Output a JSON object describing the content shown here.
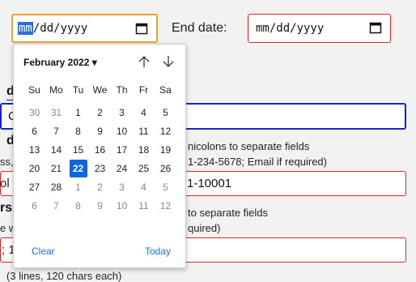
{
  "start_date": {
    "seg_month": "mm",
    "rest": "/dd/yyyy"
  },
  "end_date": {
    "label": "End date:",
    "value": "mm/dd/yyyy"
  },
  "background": {
    "label_d1": "d",
    "field1_char": "C",
    "label_d2": "d",
    "help1": "nicolons to separate fields",
    "help2_left": "ss,",
    "help2_right": "1-234-5678; Email if required)",
    "label_ol": "ol",
    "field2_value": "1-10001",
    "label_rs": "rs",
    "help3": "to separate fields",
    "help4_left": "e w",
    "help4_right": "quired)",
    "field3_left": "; 1",
    "footer": "(3 lines, 120 chars each)"
  },
  "calendar": {
    "month_label": "February 2022 ▾",
    "weekdays": [
      "Su",
      "Mo",
      "Tu",
      "We",
      "Th",
      "Fr",
      "Sa"
    ],
    "weeks": [
      [
        "30",
        "31",
        "1",
        "2",
        "3",
        "4",
        "5"
      ],
      [
        "6",
        "7",
        "8",
        "9",
        "10",
        "11",
        "12"
      ],
      [
        "13",
        "14",
        "15",
        "16",
        "17",
        "18",
        "19"
      ],
      [
        "20",
        "21",
        "22",
        "23",
        "24",
        "25",
        "26"
      ],
      [
        "27",
        "28",
        "1",
        "2",
        "3",
        "4",
        "5"
      ],
      [
        "6",
        "7",
        "8",
        "9",
        "10",
        "11",
        "12"
      ]
    ],
    "selected_day": "22",
    "clear_label": "Clear",
    "today_label": "Today",
    "accent": "#0b66e0"
  }
}
